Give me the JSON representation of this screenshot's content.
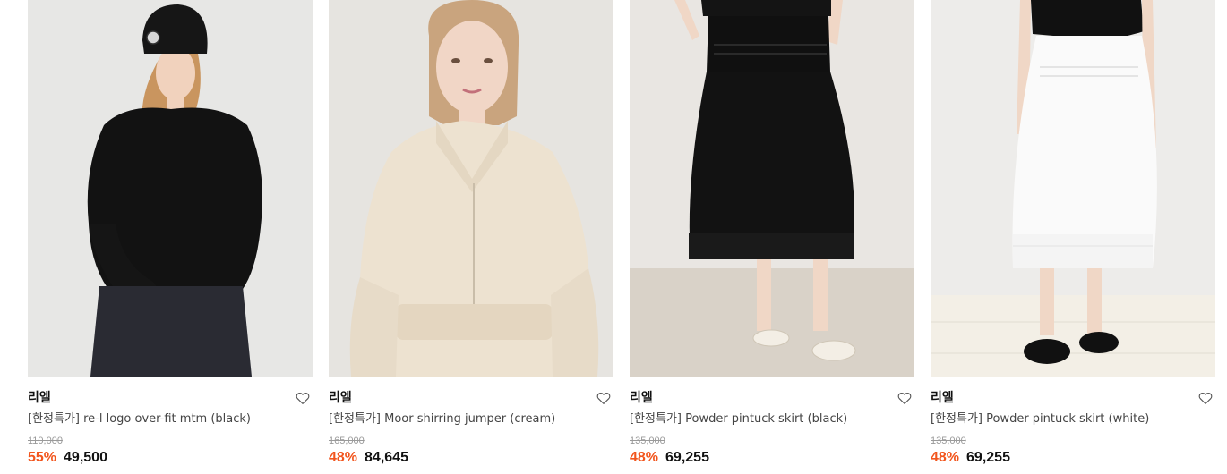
{
  "products": [
    {
      "brand": "리엘",
      "name": "[한정특가] re-l logo over-fit mtm (black)",
      "original_price": "110,000",
      "discount": "55%",
      "price": "49,500",
      "image": "model-black-sweatshirt-beanie"
    },
    {
      "brand": "리엘",
      "name": "[한정특가] Moor shirring jumper (cream)",
      "original_price": "165,000",
      "discount": "48%",
      "price": "84,645",
      "image": "model-cream-zip-jumper"
    },
    {
      "brand": "리엘",
      "name": "[한정특가] Powder pintuck skirt (black)",
      "original_price": "135,000",
      "discount": "48%",
      "price": "69,255",
      "image": "model-black-pintuck-skirt"
    },
    {
      "brand": "리엘",
      "name": "[한정특가] Powder pintuck skirt (white)",
      "original_price": "135,000",
      "discount": "48%",
      "price": "69,255",
      "image": "model-white-pintuck-skirt"
    }
  ],
  "colors": {
    "discount": "#f2551d",
    "text": "#111111",
    "muted": "#9a9a9a"
  },
  "icons": {
    "wishlist": "heart-outline-icon"
  }
}
